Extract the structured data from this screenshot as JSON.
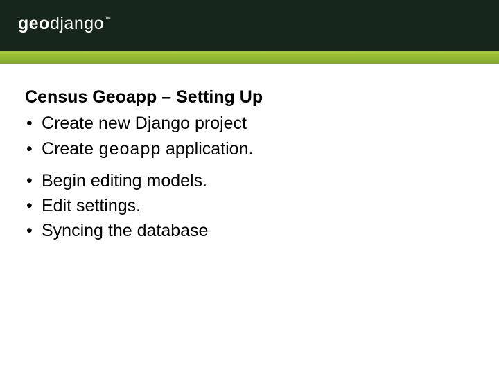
{
  "brand": {
    "prefix": "geo",
    "suffix": "django",
    "tm": "™"
  },
  "slide": {
    "title": "Census Geoapp – Setting Up",
    "group1": [
      {
        "text": "Create new Django project"
      },
      {
        "pre": "Create ",
        "code": "geoapp",
        "post": " application."
      }
    ],
    "group2": [
      {
        "text": "Begin editing models."
      },
      {
        "text": "Edit settings."
      },
      {
        "text": "Syncing the database"
      }
    ]
  }
}
